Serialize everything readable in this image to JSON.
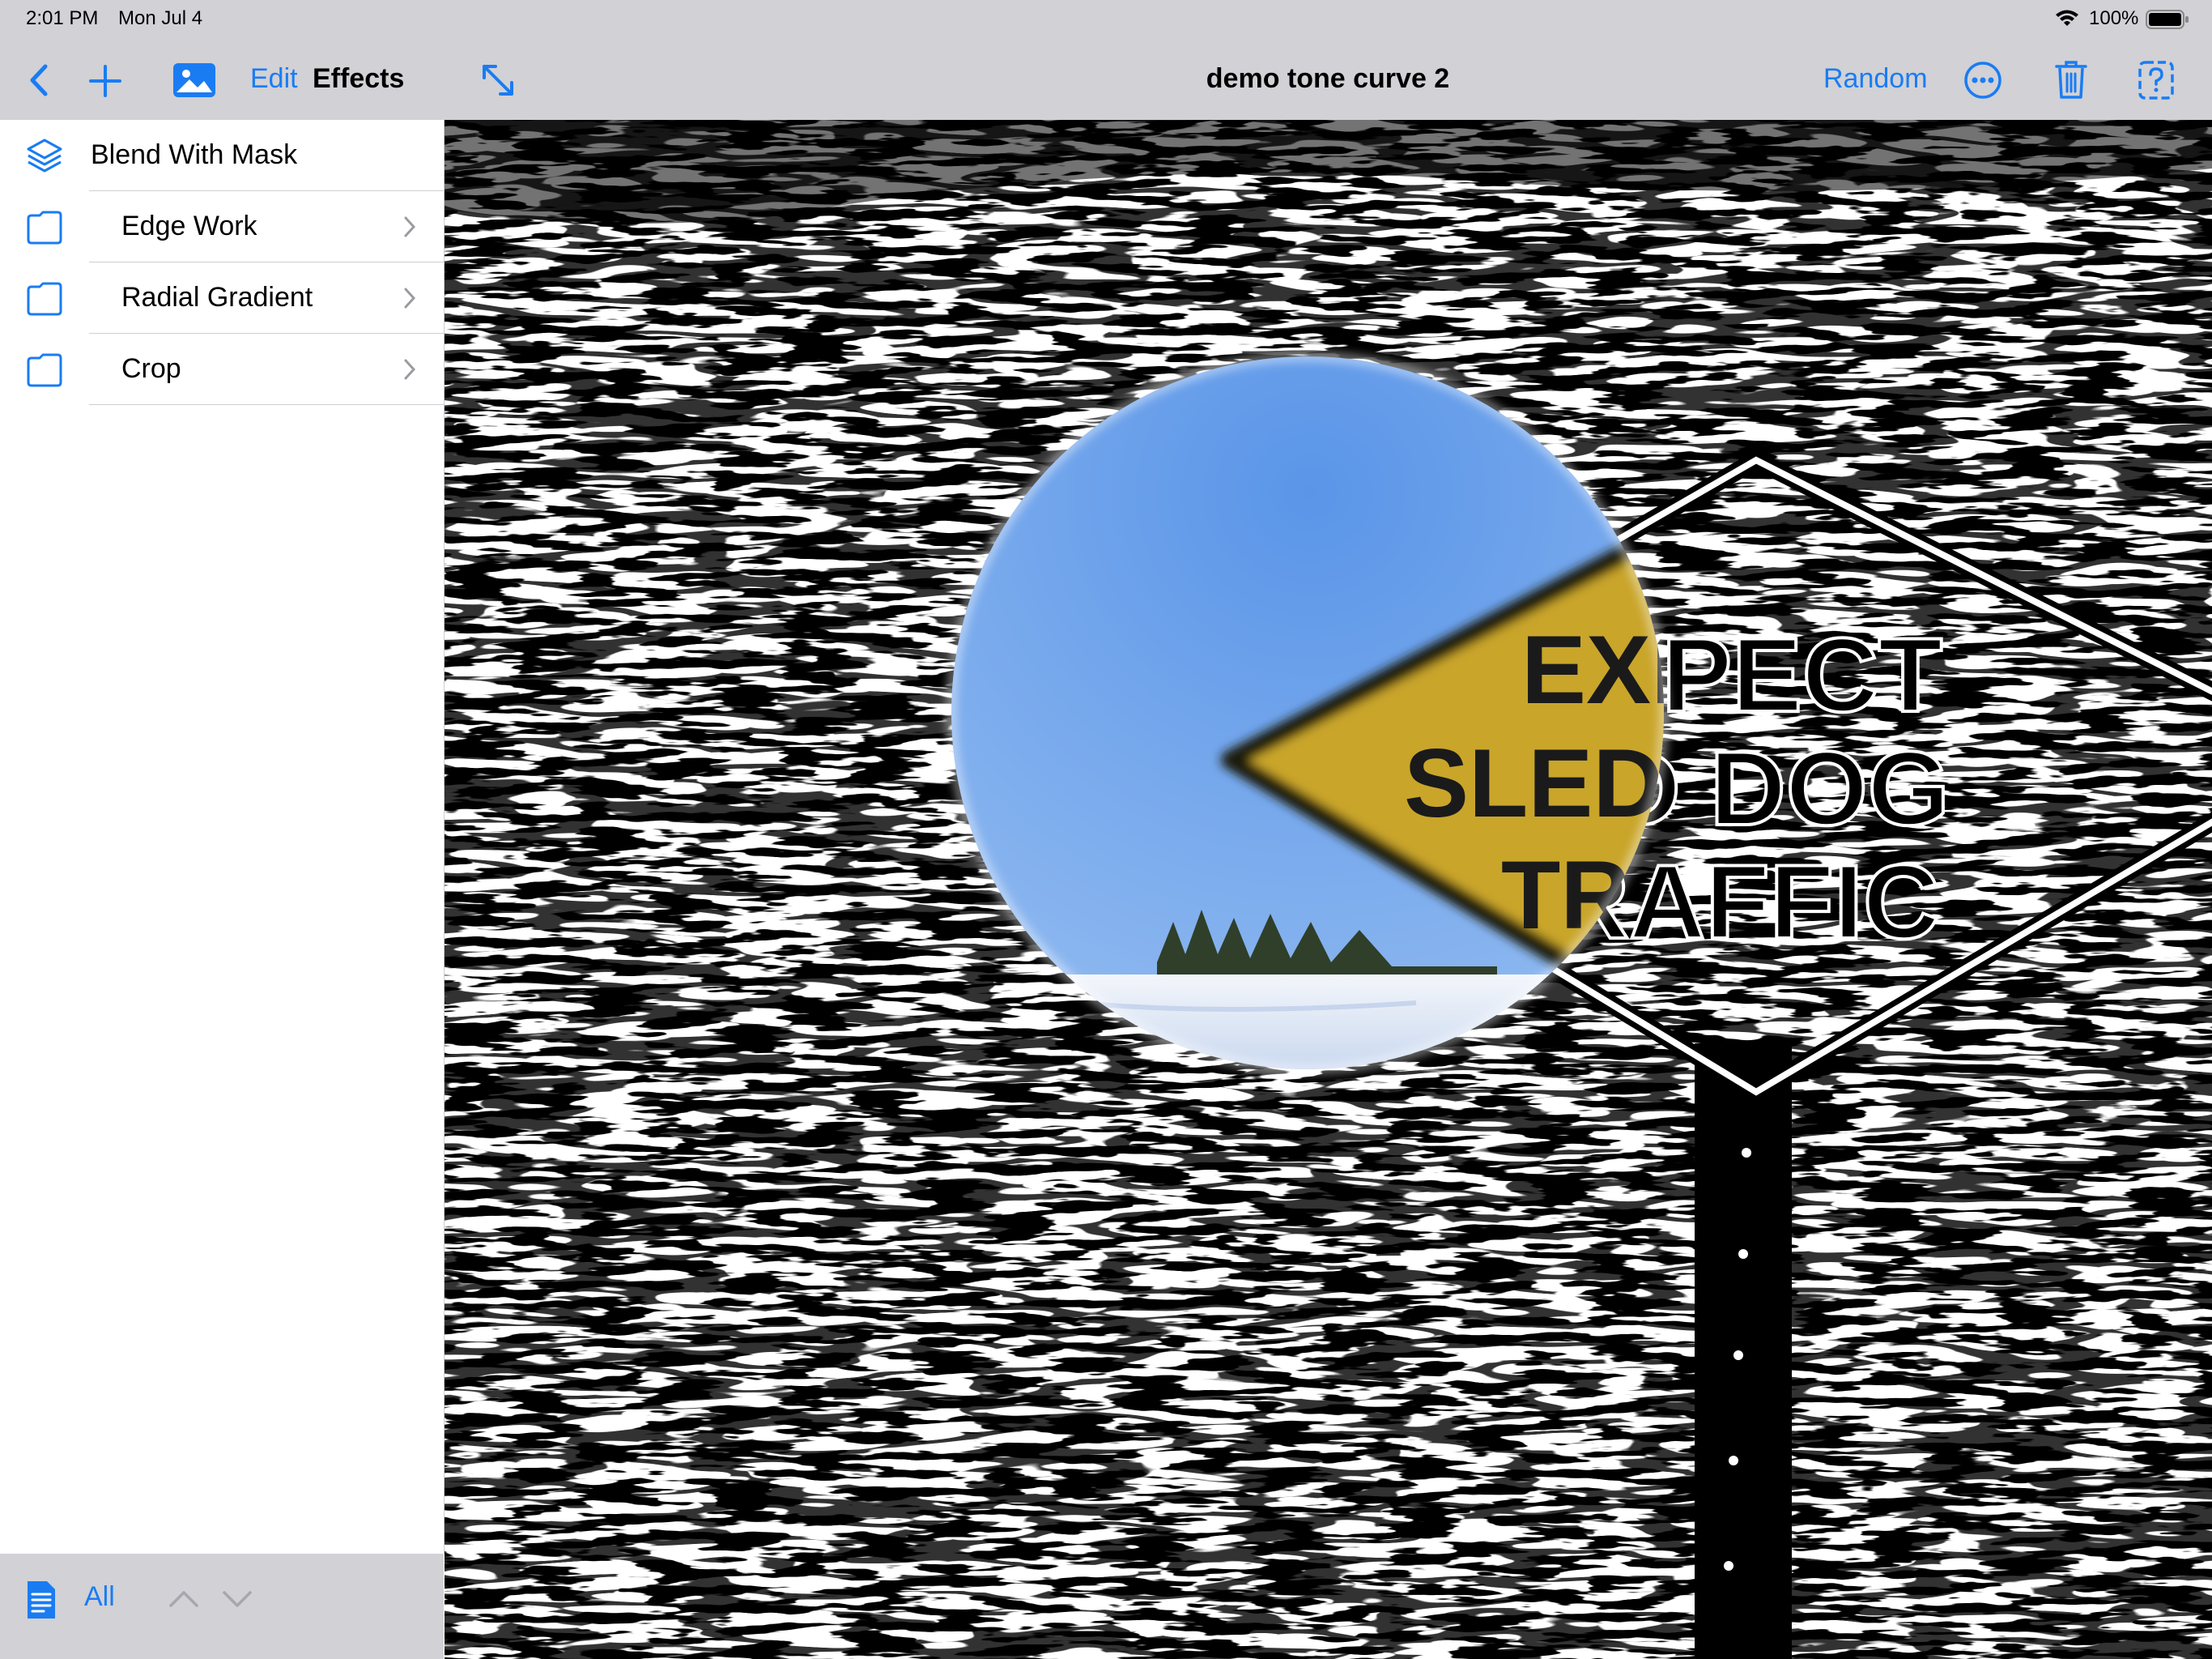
{
  "status_bar": {
    "time": "2:01 PM",
    "date": "Mon Jul 4",
    "battery_percent": "100%",
    "battery_level": 1.0
  },
  "toolbar": {
    "back_icon": "chevron-left-icon",
    "add_icon": "plus-icon",
    "image_icon": "photo-icon",
    "edit_label": "Edit",
    "section_title": "Effects",
    "expand_icon": "expand-arrows-icon",
    "document_title": "demo tone curve 2",
    "random_label": "Random",
    "more_icon": "ellipsis-circle-icon",
    "delete_icon": "trash-icon",
    "help_icon": "help-square-icon"
  },
  "sidebar": {
    "items": [
      {
        "label": "Blend With Mask",
        "icon": "layers-icon",
        "has_chevron": false
      },
      {
        "label": "Edge Work",
        "icon": "folder-icon",
        "has_chevron": true
      },
      {
        "label": "Radial Gradient",
        "icon": "folder-icon",
        "has_chevron": true
      },
      {
        "label": "Crop",
        "icon": "folder-icon",
        "has_chevron": true
      }
    ]
  },
  "bottom_bar": {
    "doc_icon": "document-text-icon",
    "filter_label": "All",
    "up_icon": "chevron-up-icon",
    "down_icon": "chevron-down-icon"
  },
  "canvas": {
    "sign_lines": [
      "EXPECT",
      "SLED DOG",
      "TRAFFIC"
    ]
  },
  "colors": {
    "accent": "#1a7cf2",
    "chrome": "#d1d1d6",
    "sign_yellow": "#c9a52c",
    "sky": "#5d97e6"
  }
}
